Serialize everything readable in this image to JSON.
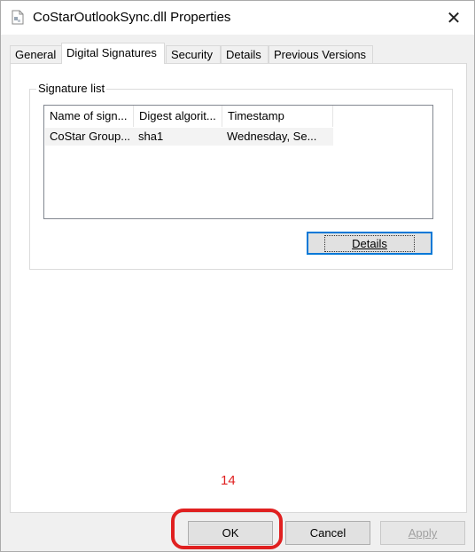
{
  "window": {
    "title": "CoStarOutlookSync.dll Properties",
    "close_glyph": "✕"
  },
  "tabs": [
    {
      "label": "General"
    },
    {
      "label": "Digital Signatures"
    },
    {
      "label": "Security"
    },
    {
      "label": "Details"
    },
    {
      "label": "Previous Versions"
    }
  ],
  "signature_group": {
    "label": "Signature list",
    "columns": [
      "Name of sign...",
      "Digest algorit...",
      "Timestamp"
    ],
    "rows": [
      {
        "name": "CoStar Group...",
        "digest": "sha1",
        "timestamp": "Wednesday, Se..."
      }
    ],
    "details_button": "Details"
  },
  "annotation": {
    "text": "14",
    "color": "#e02020"
  },
  "buttons": {
    "ok": "OK",
    "cancel": "Cancel",
    "apply": "Apply"
  },
  "colors": {
    "accent": "#0078d7",
    "highlight": "#e02020"
  }
}
